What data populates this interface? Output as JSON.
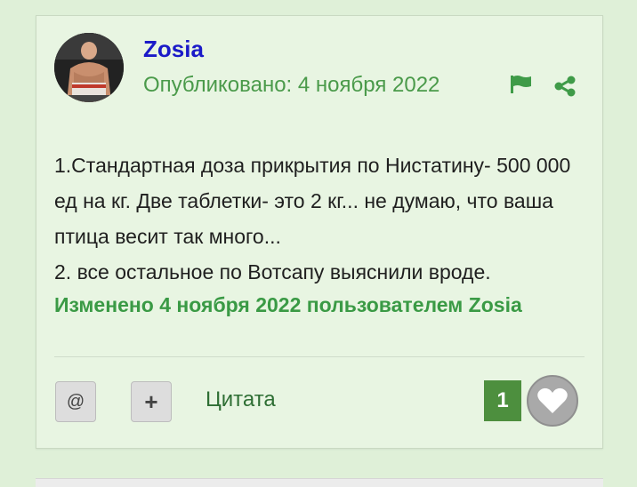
{
  "post": {
    "author": "Zosia",
    "published": "Опубликовано: 4 ноября 2022",
    "content": [
      "1.Стандартная доза прикрытия по Нистатину- 500 000 ед на кг. Две таблетки- это 2 кг... не думаю, что ваша птица весит так много...",
      "2. все остальное по Вотсапу выяснили вроде."
    ],
    "edited": "Изменено 4 ноября 2022 пользователем Zosia",
    "actions": {
      "mention_label": "@",
      "plus_label": "+",
      "quote_label": "Цитата"
    },
    "like_count": "1",
    "icons": {
      "flag": "flag-icon",
      "share": "share-icon",
      "heart": "heart-icon",
      "avatar": "avatar-image"
    },
    "colors": {
      "author": "#1a1ac8",
      "date": "#4a9a4a",
      "edited": "#3a9a45",
      "like_count_bg": "#4d8f3e",
      "card_bg": "#e8f5e2",
      "page_bg": "#dff0d8"
    }
  }
}
